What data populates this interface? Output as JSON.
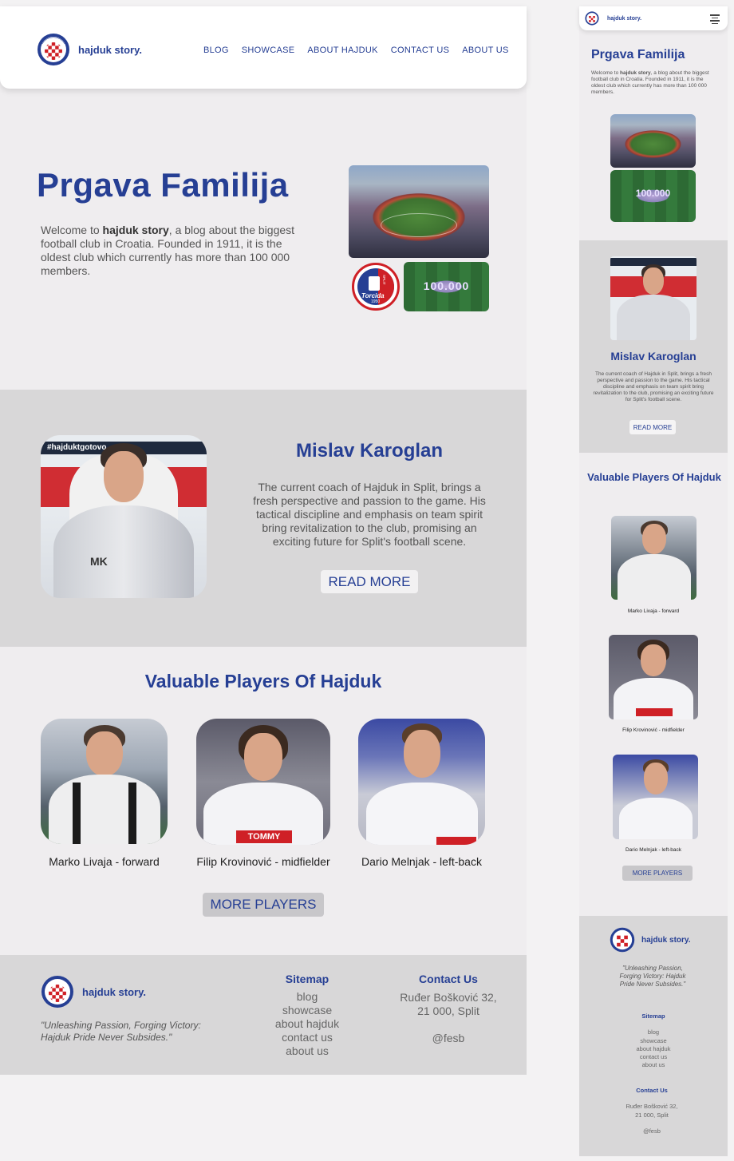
{
  "brand": {
    "name": "hajduk story.",
    "badge_text": "HAJDUK SPLIT"
  },
  "nav": {
    "items": [
      "BLOG",
      "SHOWCASE",
      "ABOUT HAJDUK",
      "CONTACT US",
      "ABOUT US"
    ]
  },
  "hero": {
    "title": "Prgava Familija",
    "text_before": "Welcome to ",
    "text_bold": "hajduk story",
    "text_after": ", a blog about the biggest football club in Croatia. Founded in 1911, it is the oldest club which currently has more than 100 000 members.",
    "badge_text": "Torcida",
    "badge_year": "1950",
    "badge_city": "SPLIT"
  },
  "coach": {
    "name": "Mislav Karoglan",
    "text": "The current coach of Hajduk in Split, brings a fresh perspective and passion to the game. His tactical discipline and emphasis on team spirit bring revitalization to the club, promising an exciting future for Split's football scene.",
    "button": "READ MORE",
    "mobile_button": "READ MORE",
    "banner_text": "#hajduktgotovo",
    "jersey_initials": "MK"
  },
  "players": {
    "title": "Valuable Players Of Hajduk",
    "items": [
      {
        "caption": "Marko Livaja - forward"
      },
      {
        "caption": "Filip Krovinović - midfielder"
      },
      {
        "caption": "Dario Melnjak - left-back"
      }
    ],
    "button": "MORE PLAYERS",
    "sponsor": "TOMMY"
  },
  "footer": {
    "quote": "\"Unleashing Passion, Forging Victory: Hajduk Pride Never Subsides.\"",
    "sitemap_title": "Sitemap",
    "sitemap": [
      "blog",
      "showcase",
      "about hajduk",
      "contact us",
      "about us"
    ],
    "contact_title": "Contact Us",
    "address_line1": "Ruđer Bošković 32,",
    "address_line2": "21 000, Split",
    "handle": "@fesb"
  },
  "stadium": {
    "pitch_text": "100.000"
  },
  "colors": {
    "brand_blue": "#263f94",
    "badge_red": "#cf2026",
    "grey_section": "#d8d7d8"
  }
}
